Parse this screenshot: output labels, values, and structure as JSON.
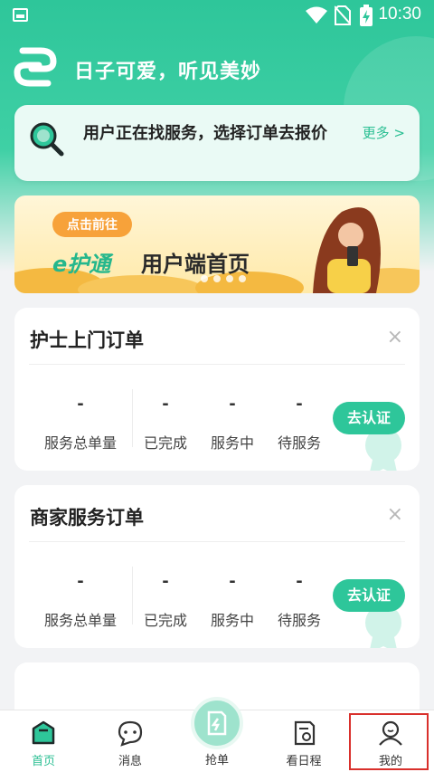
{
  "status_bar": {
    "time": "10:30"
  },
  "header": {
    "slogan": "日子可爱，听见美妙"
  },
  "notice": {
    "text": "用户正在找服务，选择订单去报价",
    "more": "更多 >"
  },
  "banner": {
    "cta": "点击前往",
    "brand": "e护通",
    "headline": "用户端首页",
    "dot_count": 4
  },
  "order_cards": [
    {
      "title": "护士上门订单",
      "close": "×",
      "stats": [
        {
          "value": "-",
          "label": "服务总单量"
        },
        {
          "value": "-",
          "label": "已完成"
        },
        {
          "value": "-",
          "label": "服务中"
        },
        {
          "value": "-",
          "label": "待服务"
        }
      ],
      "action": "去认证"
    },
    {
      "title": "商家服务订单",
      "close": "×",
      "stats": [
        {
          "value": "-",
          "label": "服务总单量"
        },
        {
          "value": "-",
          "label": "已完成"
        },
        {
          "value": "-",
          "label": "服务中"
        },
        {
          "value": "-",
          "label": "待服务"
        }
      ],
      "action": "去认证"
    }
  ],
  "tabbar": {
    "items": [
      {
        "label": "首页",
        "icon": "home-icon",
        "active": true
      },
      {
        "label": "消息",
        "icon": "message-icon",
        "active": false
      },
      {
        "label": "抢单",
        "icon": "grab-order-icon",
        "active": false
      },
      {
        "label": "看日程",
        "icon": "schedule-icon",
        "active": false
      },
      {
        "label": "我的",
        "icon": "profile-icon",
        "active": false
      }
    ]
  },
  "colors": {
    "accent": "#2ec69a",
    "highlight": "#d9302c",
    "cta": "#f7a23a"
  }
}
